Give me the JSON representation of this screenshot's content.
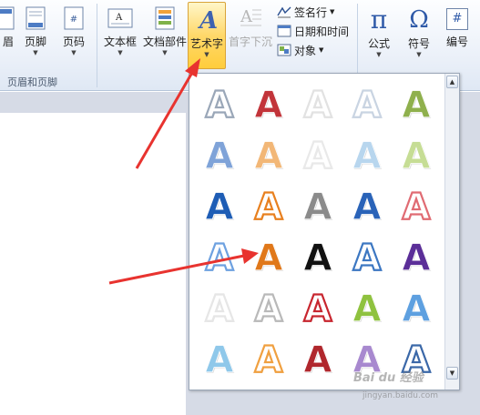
{
  "ribbon": {
    "partial_label_left": "眉",
    "footer_label": "页脚",
    "pagenum_label": "页码",
    "group_header_footer": "页眉和页脚",
    "textbox_label": "文本框",
    "quickparts_label": "文档部件",
    "wordart_label": "艺术字",
    "dropcap_label": "首字下沉",
    "signature_label": "签名行",
    "datetime_label": "日期和时间",
    "object_label": "对象",
    "equation_label": "公式",
    "symbol_label": "符号",
    "number_label": "编号",
    "pi_glyph": "π",
    "omega_glyph": "Ω",
    "number_glyph": "#"
  },
  "gallery": {
    "letter": "A",
    "styles": [
      [
        "#9aa7b8",
        "#c2343a",
        "#e2e2e2",
        "#c9d4e2",
        "#8fb04d"
      ],
      [
        "#7fa3d8",
        "#f2b777",
        "#e9e9e9",
        "#b8d6ee",
        "#c6dd95"
      ],
      [
        "#1e5db5",
        "#e8801f",
        "#8b8b8b",
        "#2a63b8",
        "#e06b73"
      ],
      [
        "#6ea1e0",
        "#e0781a",
        "#111111",
        "#3c77c2",
        "#5b2e98"
      ],
      [
        "#e6e6e6",
        "#b9b9b9",
        "#c8262f",
        "#8fc23f",
        "#5ea0e0"
      ],
      [
        "#8fc8ea",
        "#f0a040",
        "#b0272d",
        "#a889cf",
        "#3b68a8"
      ]
    ]
  },
  "watermark": {
    "text": "Bai du 经验",
    "sub": "jingyan.baidu.com"
  }
}
